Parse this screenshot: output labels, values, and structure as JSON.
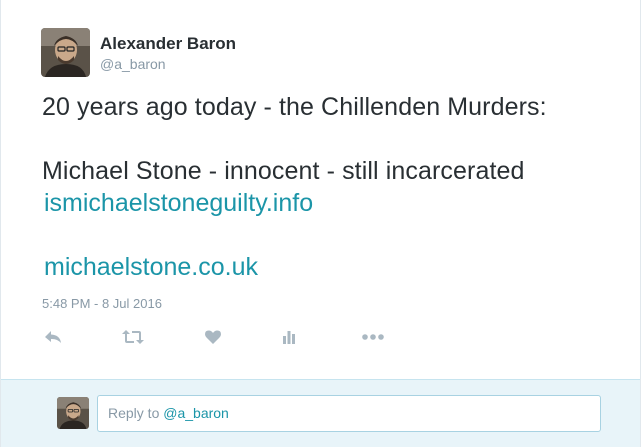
{
  "user": {
    "name": "Alexander Baron",
    "handle": "@a_baron"
  },
  "tweet": {
    "line1": "20 years ago today - the Chillenden Murders:",
    "line2": "Michael Stone - innocent - still incarcerated",
    "link1": "ismichaelstoneguilty.info",
    "link2": "michaelstone.co.uk",
    "timestamp": "5:48 PM - 8 Jul 2016"
  },
  "actions": {
    "icons": [
      "reply-icon",
      "retweet-icon",
      "like-icon",
      "analytics-icon",
      "more-icon"
    ]
  },
  "reply_box": {
    "prefix": "Reply to ",
    "mention": "@a_baron"
  },
  "colors": {
    "text": "#292f33",
    "muted": "#8899a6",
    "link": "#1b95a8",
    "icon": "#aab8c2",
    "reply_bg": "#e8f4f9"
  }
}
